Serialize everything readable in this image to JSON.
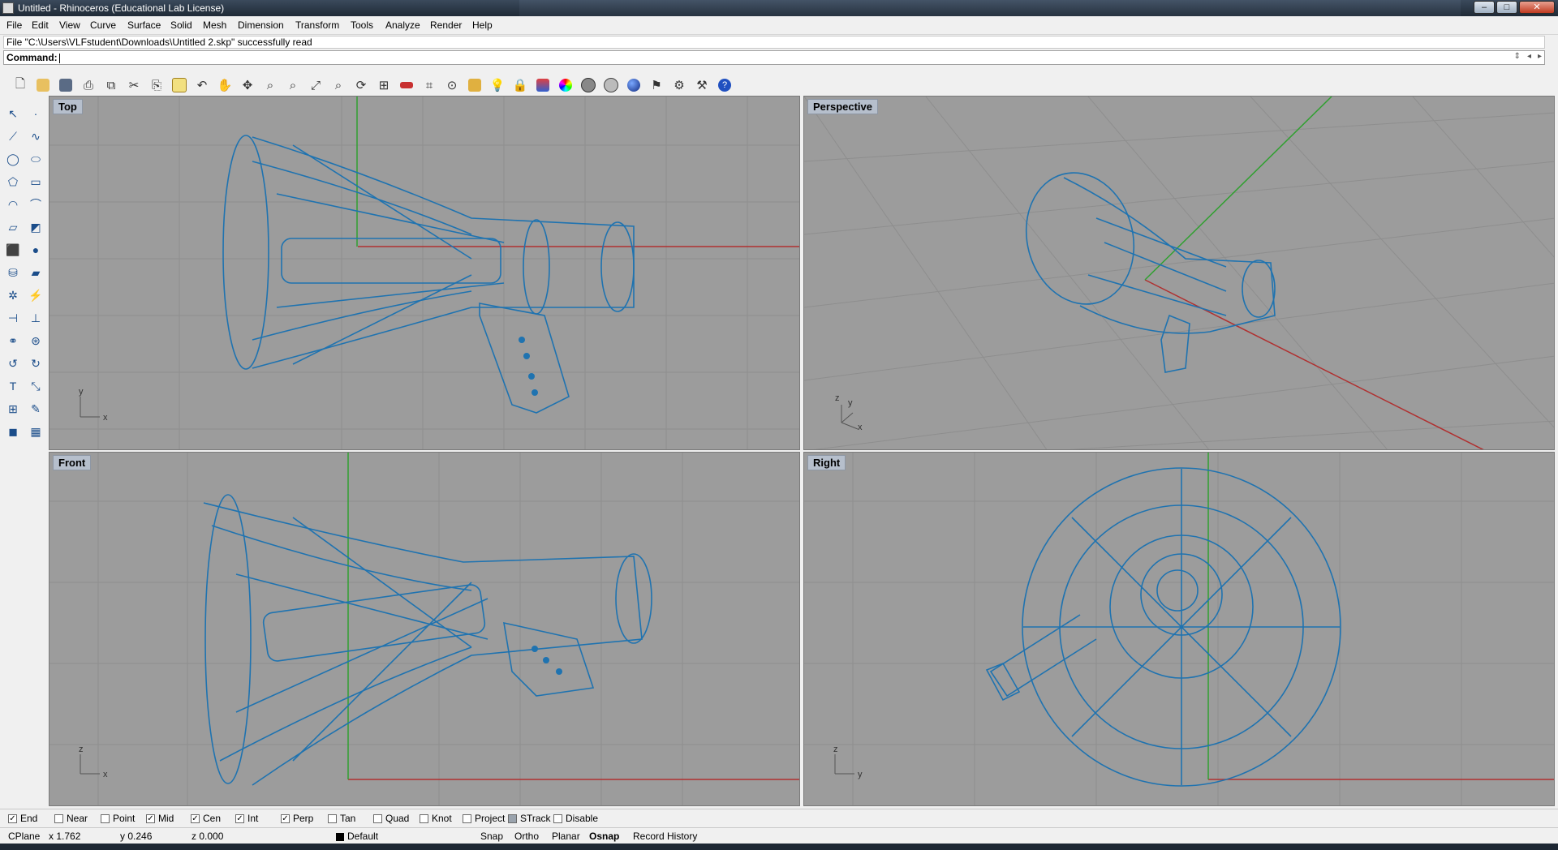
{
  "window": {
    "title": "Untitled - Rhinoceros (Educational Lab License)",
    "controls": [
      "–",
      "□",
      "✕"
    ]
  },
  "menu": [
    "File",
    "Edit",
    "View",
    "Curve",
    "Surface",
    "Solid",
    "Mesh",
    "Dimension",
    "Transform",
    "Tools",
    "Analyze",
    "Render",
    "Help"
  ],
  "history": "File \"C:\\Users\\VLFstudent\\Downloads\\Untitled 2.skp\" successfully read",
  "command": {
    "prompt": "Command:",
    "value": ""
  },
  "toolbar_icons": [
    "new-icon",
    "open-icon",
    "save-icon",
    "print-icon",
    "import-icon",
    "cut-icon",
    "copy-icon",
    "paste-icon",
    "undo-icon",
    "pan-icon",
    "rotate-view-icon",
    "zoom-icon",
    "zoom-window-icon",
    "zoom-extents-icon",
    "zoom-selected-icon",
    "rotate-icon",
    "four-viewports-icon",
    "car-icon",
    "wireframe-icon",
    "point-icon",
    "grid-snap-icon",
    "light-icon",
    "lock-icon",
    "layer-icon",
    "color-wheel-icon",
    "render-icon",
    "mesh-icon",
    "sphere-icon",
    "flag-icon",
    "options-icon",
    "tools-icon",
    "help-icon"
  ],
  "sidebar_icons": [
    "select-icon",
    "point-icon",
    "polyline-icon",
    "curve-icon",
    "circle-icon",
    "ellipse-icon",
    "polygon-icon",
    "rectangle-icon",
    "arc-icon",
    "fillet-icon",
    "surface-icon",
    "surface-edit-icon",
    "box-icon",
    "sphere-icon",
    "cylinder-icon",
    "extrude-icon",
    "transform-icon",
    "boolean-icon",
    "split-icon",
    "trim-icon",
    "analyze-icon",
    "group-icon",
    "join-icon",
    "offset-icon",
    "text-icon",
    "dimension-icon",
    "array-icon",
    "edit-icon",
    "solid-icon",
    "mesh-icon"
  ],
  "viewports": {
    "top": "Top",
    "perspective": "Perspective",
    "front": "Front",
    "right": "Right"
  },
  "axis_labels": {
    "top": [
      "y",
      "x"
    ],
    "perspective": [
      "z",
      "y",
      "x"
    ],
    "front": [
      "z",
      "x"
    ],
    "right": [
      "z",
      "y"
    ]
  },
  "osnaps": [
    {
      "label": "End",
      "checked": true
    },
    {
      "label": "Near",
      "checked": false
    },
    {
      "label": "Point",
      "checked": false
    },
    {
      "label": "Mid",
      "checked": true
    },
    {
      "label": "Cen",
      "checked": true
    },
    {
      "label": "Int",
      "checked": true
    },
    {
      "label": "Perp",
      "checked": true
    },
    {
      "label": "Tan",
      "checked": false
    },
    {
      "label": "Quad",
      "checked": false
    },
    {
      "label": "Knot",
      "checked": false
    },
    {
      "label": "Project",
      "checked": false
    },
    {
      "label": "STrack",
      "checked": false
    },
    {
      "label": "Disable",
      "checked": false
    }
  ],
  "status": {
    "cplane": "CPlane",
    "x": "x 1.762",
    "y": "y 0.246",
    "z": "z 0.000",
    "layer": "Default",
    "snap": "Snap",
    "ortho": "Ortho",
    "planar": "Planar",
    "osnap": "Osnap",
    "record_history": "Record History"
  },
  "colors": {
    "wire": "#1f73b0",
    "viewport_bg": "#9c9c9c",
    "grid": "#8e8e8e",
    "x_axis": "#b03030",
    "y_axis": "#30a030"
  }
}
